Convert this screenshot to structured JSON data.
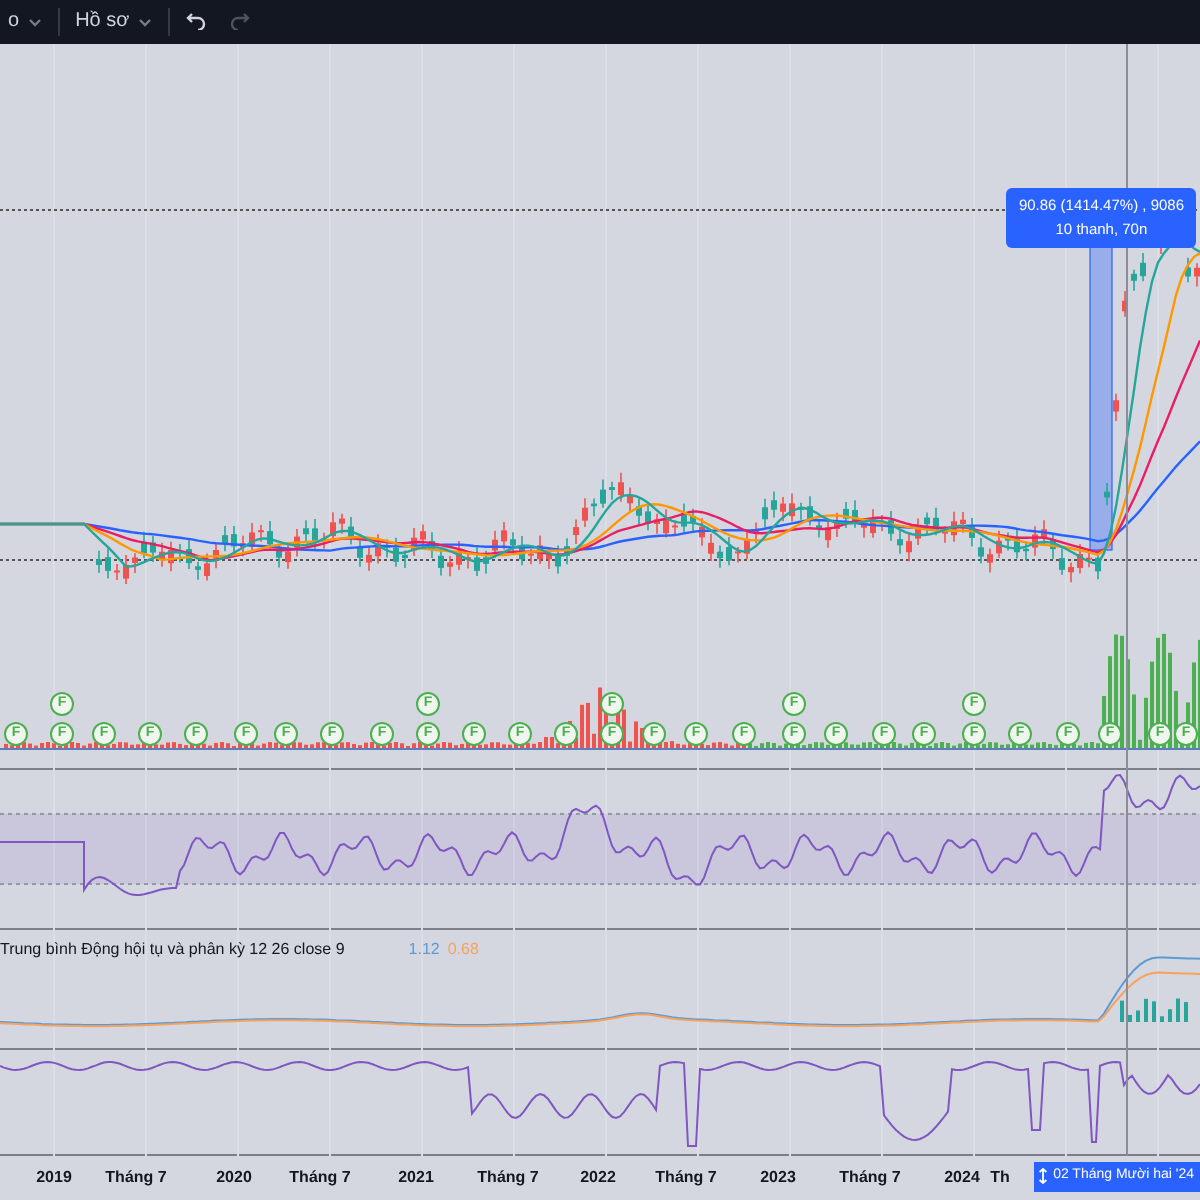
{
  "toolbar": {
    "items": [
      {
        "kind": "dropdown",
        "label": "o"
      },
      {
        "kind": "dropdown",
        "label": "Hồ sơ"
      },
      {
        "kind": "undo",
        "disabled": false
      },
      {
        "kind": "redo",
        "disabled": true
      }
    ]
  },
  "measure_tooltip": {
    "lines": [
      "90.86 (1414.47%) , 9086",
      "10 thanh, 70n"
    ]
  },
  "earnings_markers": {
    "upper": [
      "F",
      "F",
      "F",
      "F",
      "F"
    ],
    "lower": [
      "F",
      "F",
      "F",
      "F",
      "F",
      "F",
      "F",
      "F",
      "F",
      "F",
      "F",
      "F",
      "F",
      "F",
      "F",
      "F",
      "F",
      "F",
      "F",
      "F",
      "F",
      "F",
      "F",
      "F",
      "F",
      "F",
      "F"
    ]
  },
  "macd_legend": {
    "title": "Trung bình Động hội tụ và phân kỳ 12 26 close 9",
    "values": [
      {
        "text": "1.12",
        "color": "#5b9bd5"
      },
      {
        "text": "0.68",
        "color": "#f7a35c"
      }
    ]
  },
  "time_axis": {
    "labels": [
      "2019",
      "Tháng 7",
      "2020",
      "Tháng 7",
      "2021",
      "Tháng 7",
      "2022",
      "Tháng 7",
      "2023",
      "Tháng 7",
      "2024",
      "Th"
    ],
    "crosshair_label": "02 Tháng Mười hai '24"
  }
}
